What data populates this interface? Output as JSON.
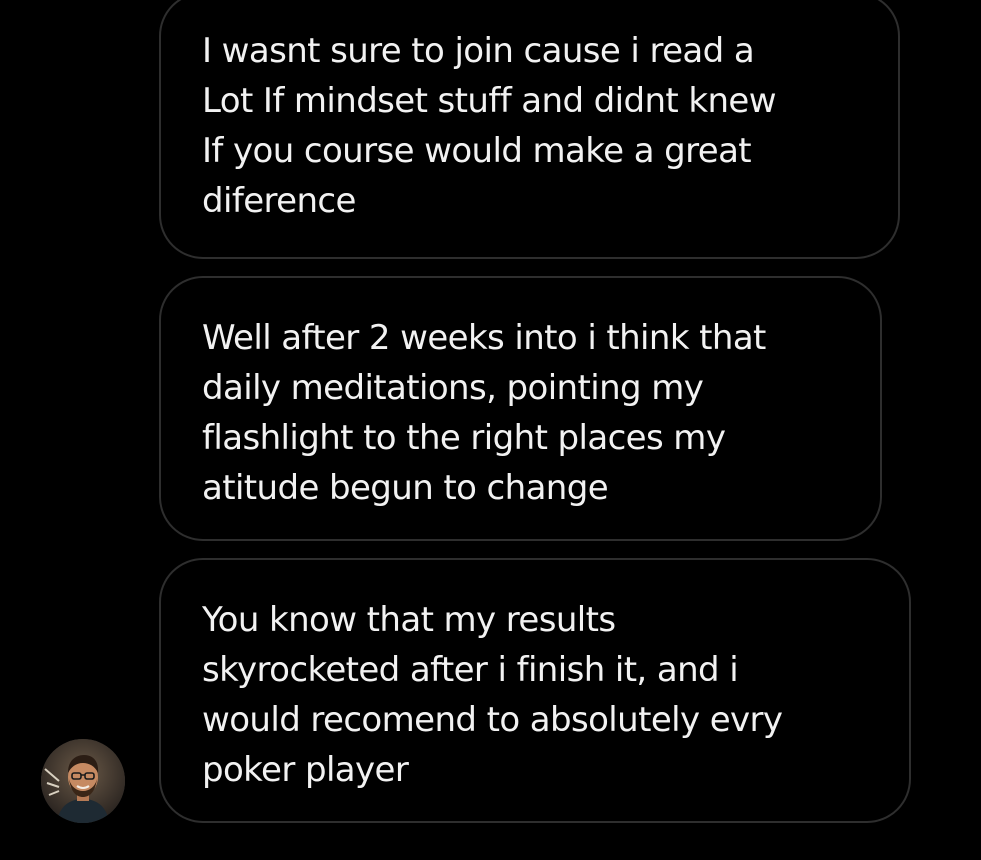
{
  "conversation": {
    "messages": [
      {
        "text": "I wasnt sure to join cause i read a\nLot If mindset stuff and didnt knew\nIf you course would make a great\ndiference"
      },
      {
        "text": "Well after 2 weeks into i think that\ndaily meditations, pointing my\nflashlight to the right places my\natitude begun to change"
      },
      {
        "text": "You know that my results\nskyrocketed after i finish it, and i\nwould recomend to absolutely evry\npoker player"
      }
    ],
    "sender_avatar_icon": "person-avatar-icon"
  },
  "colors": {
    "background": "#000000",
    "bubble_border": "#2e2e2e",
    "text": "#f2f2f2"
  }
}
